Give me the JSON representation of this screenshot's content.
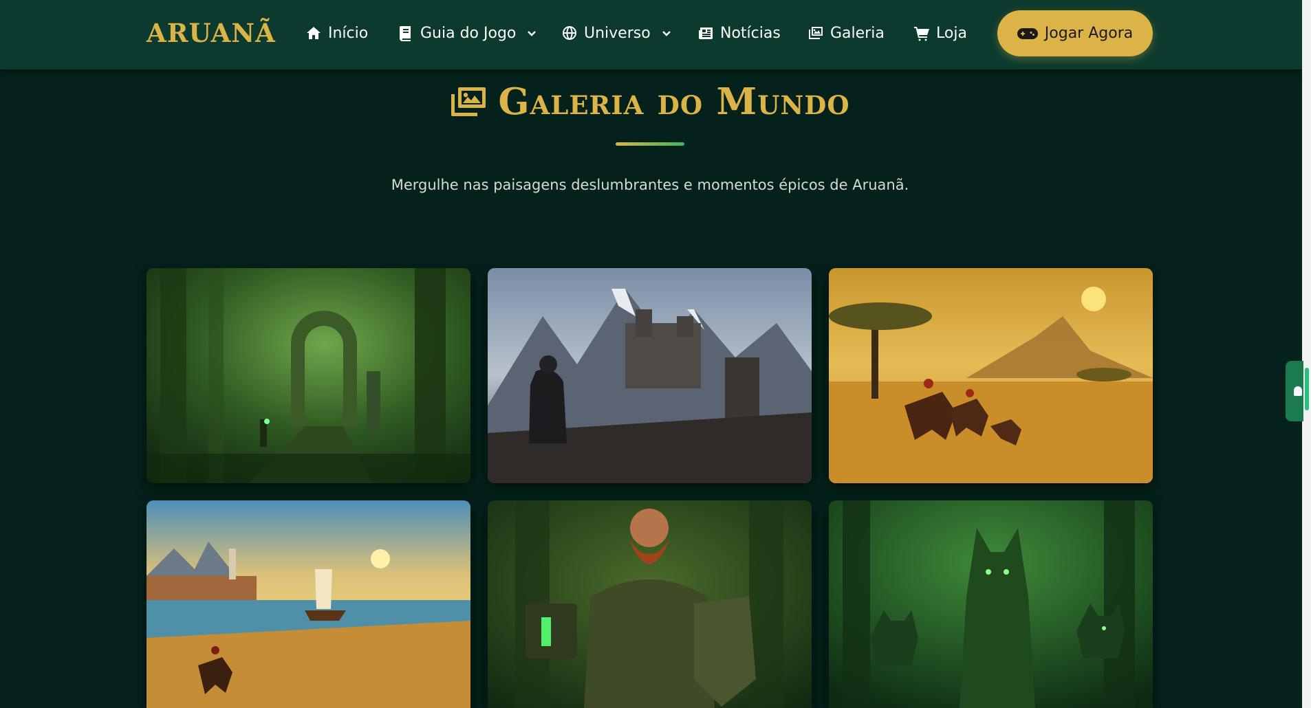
{
  "header": {
    "logo": "ARUANÃ",
    "nav": [
      {
        "label": "Início",
        "icon": "home-icon"
      },
      {
        "label": "Guia do Jogo",
        "icon": "book-icon",
        "dropdown": true
      },
      {
        "label": "Universo",
        "icon": "globe-icon",
        "dropdown": true
      },
      {
        "label": "Notícias",
        "icon": "newspaper-icon"
      },
      {
        "label": "Galeria",
        "icon": "images-icon"
      },
      {
        "label": "Loja",
        "icon": "cart-icon"
      }
    ],
    "cta": {
      "label": "Jogar Agora",
      "icon": "gamepad-icon"
    }
  },
  "gallery": {
    "title": "Galeria do Mundo",
    "icon": "images-icon",
    "subtitle": "Mergulhe nas paisagens deslumbrantes e momentos épicos de Aruanã."
  },
  "colors": {
    "background": "#05211b",
    "header": "#0c3a2f",
    "accent": "#dcb347",
    "divider_end": "#3fb562"
  }
}
